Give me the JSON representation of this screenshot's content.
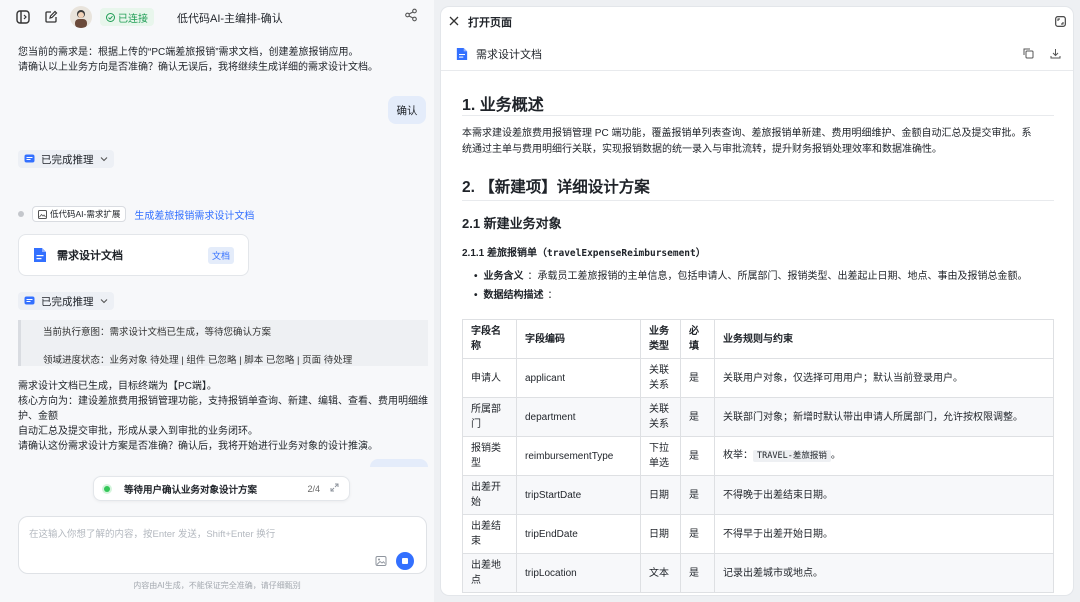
{
  "chat": {
    "title": "低代码AI-主编排-确认",
    "status": "已连接",
    "messages": {
      "assistant_1_line1": "您当前的需求是：根据上传的“PC端差旅报销”需求文档，创建差旅报销应用。",
      "assistant_1_line2": "请确认以上业务方向是否准确？确认无误后，我将继续生成详细的需求设计文档。",
      "user_1": "确认",
      "reasoning_1": "已完成推理",
      "tool_tag": "低代码AI-需求扩展",
      "tool_desc": "生成差旅报销需求设计文档",
      "doc_card_title": "需求设计文档",
      "doc_card_badge": "文档",
      "reasoning_2": "已完成推理",
      "quote_line1": "当前执行意图：需求设计文档已生成，等待您确认方案",
      "quote_line2": "领域进度状态：业务对象 待处理 | 组件 已忽略 | 脚本 已忽略 | 页面 待处理",
      "assistant_2_line1": "需求设计文档已生成，目标终端为【PC端】。",
      "assistant_2_line2": "核心方向为：建设差旅费用报销管理功能，支持报销单查询、新建、编辑、查看、费用明细维护、金额",
      "assistant_2_line3": "自动汇总及提交审批，形成从录入到审批的业务闭环。",
      "assistant_2_line4": "请确认这份需求设计方案是否准确？确认后，我将开始进行业务对象的设计推演。"
    },
    "progress": {
      "label": "等待用户确认业务对象设计方案",
      "count": "2/4"
    },
    "input": {
      "placeholder": "在这输入你想了解的内容，按Enter 发送，Shift+Enter 换行",
      "value": ""
    },
    "disclaimer": "内容由AI生成，不能保证完全准确，请仔细甄别"
  },
  "panel": {
    "title": "打开页面",
    "tab_title": "需求设计文档",
    "doc": {
      "h1": "1. 业务概述",
      "para_line1": "本需求建设差旅费用报销管理 PC 端功能，覆盖报销单列表查询、差旅报销单新建、费用明细维护、金额自动汇总及提交审批。系",
      "para_line2": "统通过主单与费用明细行关联，实现报销数据的统一录入与审批流转，提升财务报销处理效率和数据准确性。",
      "h2": "2. 【新建项】详细设计方案",
      "h3": "2.1 新建业务对象",
      "h4_prefix": "2.1.1 差旅报销单（",
      "h4_code": "travelExpenseReimbursement",
      "h4_suffix": "）",
      "bullet1_label": "业务含义",
      "bullet1_text": "：承载员工差旅报销的主单信息，包括申请人、所属部门、报销类型、出差起止日期、地点、事由及报销总金额。",
      "bullet2_label": "数据结构描述",
      "bullet2_text": "："
    },
    "table": {
      "headers": [
        "字段名称",
        "字段编码",
        "业务类型",
        "必填",
        "业务规则与约束"
      ],
      "rows": [
        [
          "申请人",
          "applicant",
          "关联关系",
          "是",
          "关联用户对象，仅选择可用用户；默认当前登录用户。"
        ],
        [
          "所属部门",
          "department",
          "关联关系",
          "是",
          "关联部门对象；新增时默认带出申请人所属部门，允许按权限调整。"
        ],
        [
          "报销类型",
          "reimbursementType",
          "下拉单选",
          "是",
          "枚举：",
          "TRAVEL-差旅报销",
          "。"
        ],
        [
          "出差开始",
          "tripStartDate",
          "日期",
          "是",
          "不得晚于出差结束日期。"
        ],
        [
          "出差结束",
          "tripEndDate",
          "日期",
          "是",
          "不得早于出差开始日期。"
        ],
        [
          "出差地点",
          "tripLocation",
          "文本",
          "是",
          "记录出差城市或地点。"
        ]
      ]
    }
  }
}
